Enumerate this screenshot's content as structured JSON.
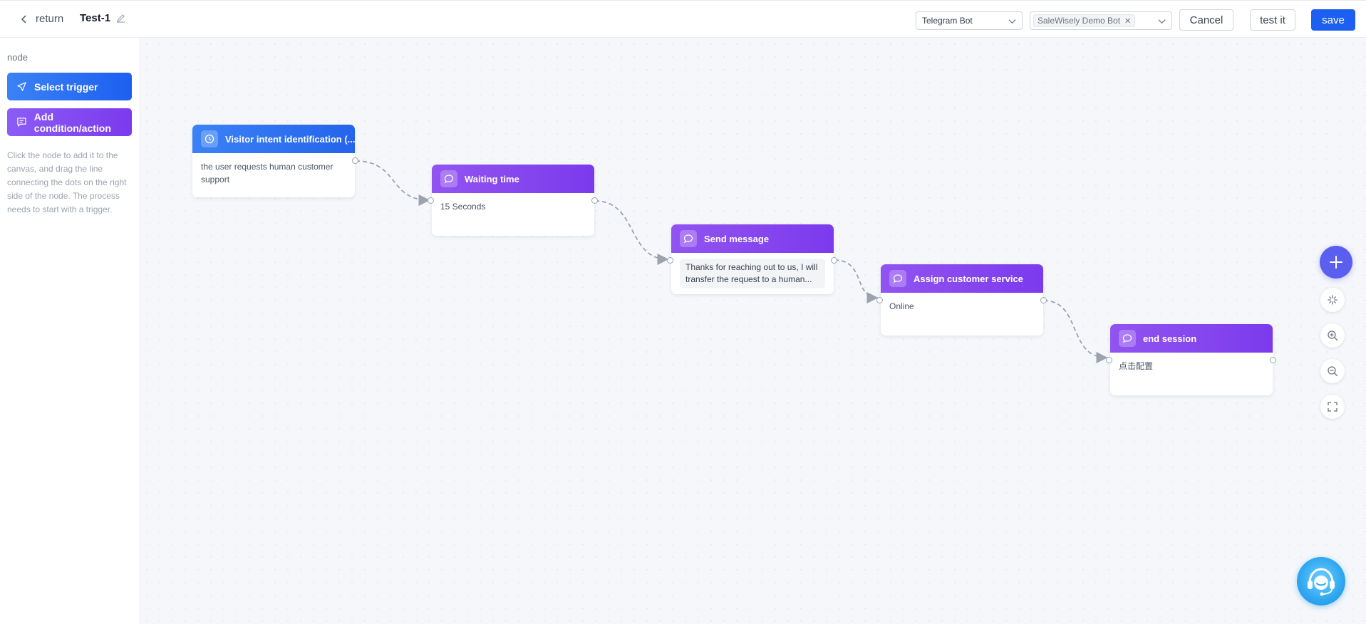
{
  "header": {
    "return_label": "return",
    "flow_name": "Test-1",
    "channel_select": "Telegram Bot",
    "bot_tag": "SaleWisely Demo Bot",
    "cancel_label": "Cancel",
    "test_label": "test it",
    "save_label": "save"
  },
  "sidebar": {
    "section_label": "node",
    "trigger_button": "Select trigger",
    "action_button": "Add condition/action",
    "help_text": "Click the node to add it to the canvas, and drag the line connecting the dots on the right side of the node. The process needs to start with a trigger."
  },
  "nodes": [
    {
      "title": "Visitor intent identification (...",
      "body": "the user requests human customer support",
      "icon": "clock-icon",
      "color": "#2563eb"
    },
    {
      "title": "Waiting time",
      "body": "15 Seconds",
      "icon": "chat-bubble-icon",
      "color": "#7c3aed"
    },
    {
      "title": "Send message",
      "body": "Thanks for reaching out to us, I will transfer the request to a human...",
      "icon": "chat-bubble-icon",
      "color": "#7c3aed"
    },
    {
      "title": "Assign customer service",
      "body": "Online",
      "icon": "chat-bubble-icon",
      "color": "#7c3aed"
    },
    {
      "title": "end session",
      "body": "点击配置",
      "icon": "chat-bubble-icon",
      "color": "#7c3aed"
    }
  ],
  "toolbar_icons": [
    "plus-icon",
    "magic-icon",
    "zoom-in-icon",
    "zoom-out-icon",
    "fullscreen-icon"
  ],
  "colors": {
    "primary": "#1d5ff0",
    "trigger": "#2563eb",
    "action": "#7c3aed",
    "canvas": "#f5f7fb"
  }
}
